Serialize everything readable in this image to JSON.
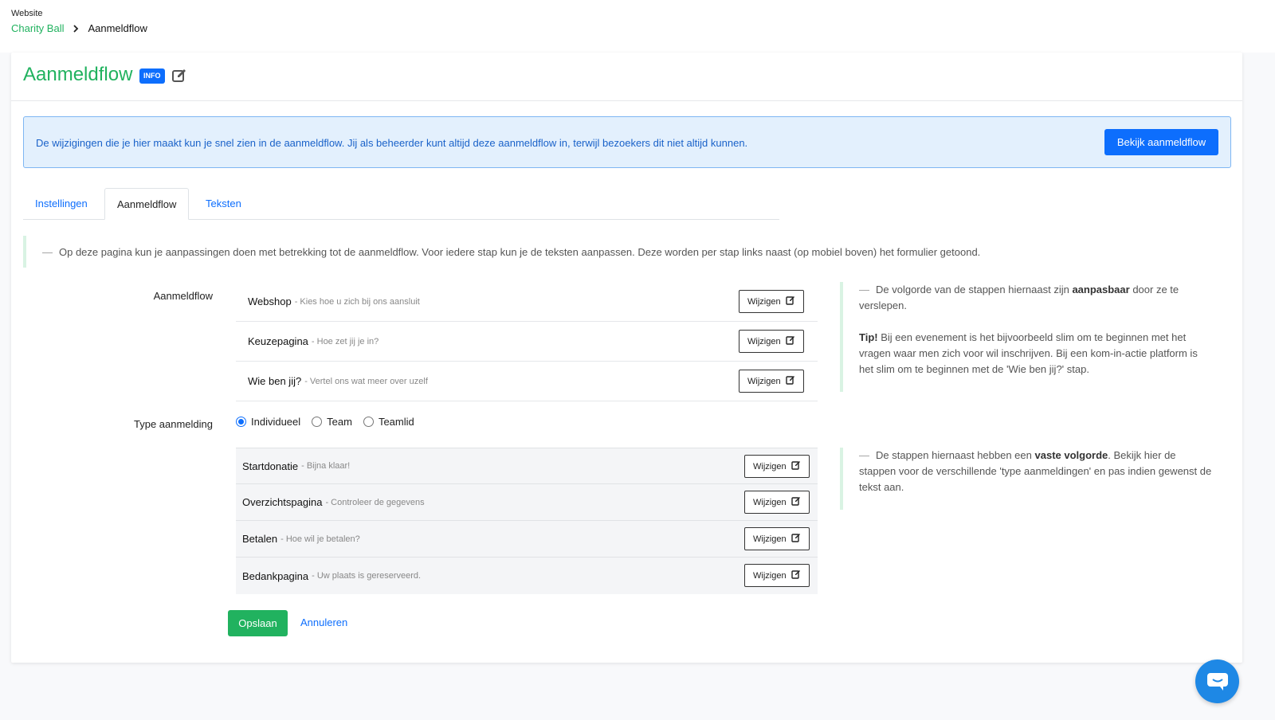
{
  "breadcrumb": {
    "section": "Website",
    "parent": "Charity Ball",
    "current": "Aanmeldflow"
  },
  "header": {
    "title": "Aanmeldflow",
    "badge": "INFO"
  },
  "alert": {
    "text": "De wijzigingen die je hier maakt kun je snel zien in de aanmeldflow. Jij als beheerder kunt altijd deze aanmeldflow in, terwijl bezoekers dit niet altijd kunnen.",
    "button": "Bekijk aanmeldflow"
  },
  "tabs": [
    {
      "label": "Instellingen"
    },
    {
      "label": "Aanmeldflow"
    },
    {
      "label": "Teksten"
    }
  ],
  "active_tab": "Aanmeldflow",
  "intro": "Op deze pagina kun je aanpassingen doen met betrekking tot de aanmeldflow. Voor iedere stap kun je de teksten aanpassen. Deze worden per stap links naast (op mobiel boven) het formulier getoond.",
  "flow": {
    "label": "Aanmeldflow",
    "steps": [
      {
        "name": "Webshop",
        "sub": "- Kies hoe u zich bij ons aansluit",
        "button": "Wijzigen"
      },
      {
        "name": "Keuzepagina",
        "sub": "- Hoe zet jij je in?",
        "button": "Wijzigen"
      },
      {
        "name": "Wie ben jij?",
        "sub": "- Vertel ons wat meer over uzelf",
        "button": "Wijzigen"
      }
    ]
  },
  "type": {
    "label": "Type aanmelding",
    "options": [
      "Individueel",
      "Team",
      "Teamlid"
    ],
    "selected": "Individueel"
  },
  "fixed_steps": [
    {
      "name": "Startdonatie",
      "sub": "- Bijna klaar!",
      "button": "Wijzigen"
    },
    {
      "name": "Overzichtspagina",
      "sub": "- Controleer de gegevens",
      "button": "Wijzigen"
    },
    {
      "name": "Betalen",
      "sub": "- Hoe wil je betalen?",
      "button": "Wijzigen"
    },
    {
      "name": "Bedankpagina",
      "sub": "- Uw plaats is gereserveerd.",
      "button": "Wijzigen"
    }
  ],
  "note1": {
    "part1": "De volgorde van de stappen hiernaast zijn ",
    "bold": "aanpasbaar",
    "part2": " door ze te verslepen.",
    "tip_bold": "Tip!",
    "tip": " Bij een evenement is het bijvoorbeeld slim om te beginnen met het vragen waar men zich voor wil inschrijven. Bij een kom-in-actie platform is het slim om te beginnen met de 'Wie ben jij?' stap."
  },
  "note2": {
    "part1": "De stappen hiernaast hebben een ",
    "bold": "vaste volgorde",
    "part2": ". Bekijk hier de stappen voor de verschillende 'type aanmeldingen' en pas indien gewenst de tekst aan."
  },
  "actions": {
    "save": "Opslaan",
    "cancel": "Annuleren"
  },
  "colors": {
    "green": "#21b25f",
    "blue": "#0d6efd",
    "alert_bg": "#e3f0fd"
  },
  "icons": [
    "chevron-right-icon",
    "edit-icon",
    "chat-icon"
  ]
}
